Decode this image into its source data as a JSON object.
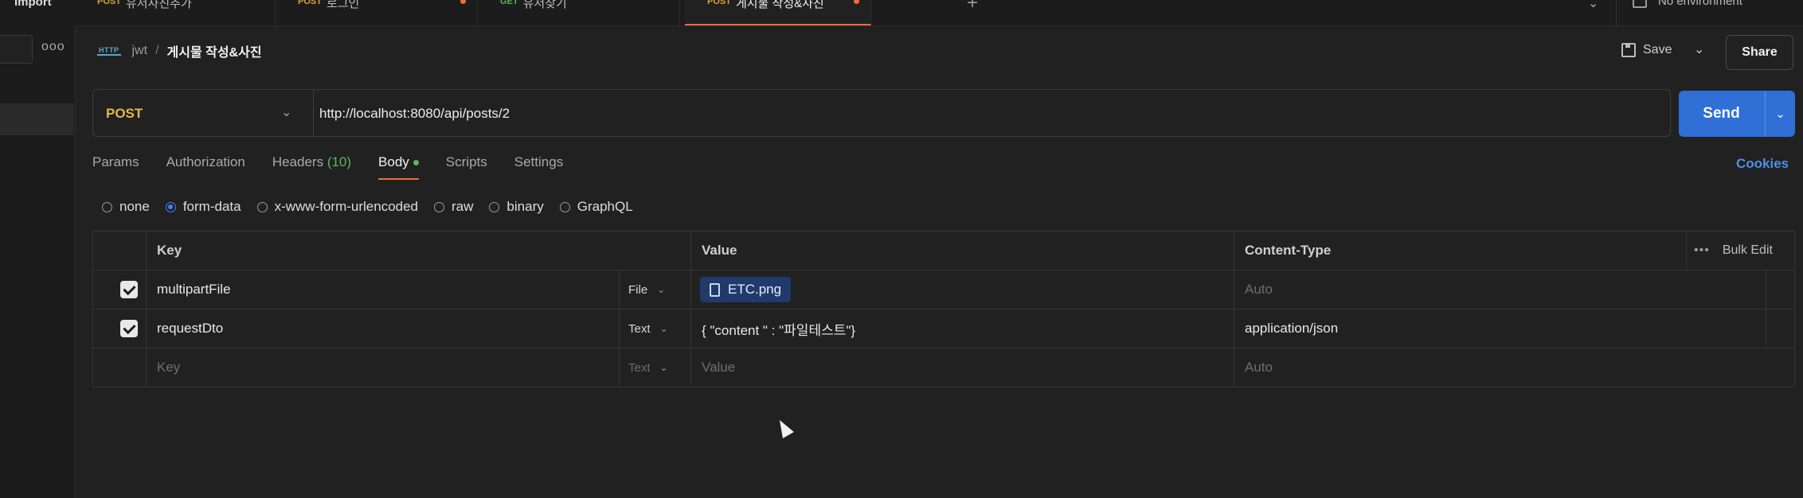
{
  "sidebar": {
    "import_label": "Import",
    "more": "ooo"
  },
  "tabs": [
    {
      "method": "POST",
      "title": "유저사진추가",
      "unsaved": false
    },
    {
      "method": "POST",
      "title": "로그인",
      "unsaved": true
    },
    {
      "method": "GET",
      "title": "유저찾기",
      "unsaved": false
    },
    {
      "method": "POST",
      "title": "게시물 작성&사진",
      "unsaved": true,
      "active": true
    }
  ],
  "environment": "No environment",
  "breadcrumb": {
    "parent": "jwt",
    "separator": "/",
    "title": "게시물 작성&사진"
  },
  "header": {
    "save_label": "Save",
    "share_label": "Share"
  },
  "request": {
    "method": "POST",
    "url": "http://localhost:8080/api/posts/2",
    "send_label": "Send"
  },
  "request_tabs": {
    "params": "Params",
    "authorization": "Authorization",
    "headers": "Headers",
    "headers_count": "(10)",
    "body": "Body",
    "scripts": "Scripts",
    "settings": "Settings",
    "cookies": "Cookies"
  },
  "body_modes": {
    "none": "none",
    "form_data": "form-data",
    "urlencoded": "x-www-form-urlencoded",
    "raw": "raw",
    "binary": "binary",
    "graphql": "GraphQL",
    "selected": "form-data"
  },
  "table": {
    "headers": {
      "key": "Key",
      "value": "Value",
      "content_type": "Content-Type",
      "bulk_edit": "Bulk Edit",
      "more": "•••"
    },
    "rows": [
      {
        "checked": true,
        "key": "multipartFile",
        "type": "File",
        "value": "ETC.png",
        "content_type": "Auto"
      },
      {
        "checked": true,
        "key": "requestDto",
        "type": "Text",
        "value": "{ \"content \" : \"파일테스트\"}",
        "content_type": "application/json"
      }
    ],
    "placeholder": {
      "key": "Key",
      "type": "Text",
      "value": "Value",
      "content_type": "Auto"
    }
  },
  "colors": {
    "accent": "#f26b3a",
    "send": "#2f6fd6",
    "post": "#e0b84a",
    "link": "#4f8fe8"
  }
}
